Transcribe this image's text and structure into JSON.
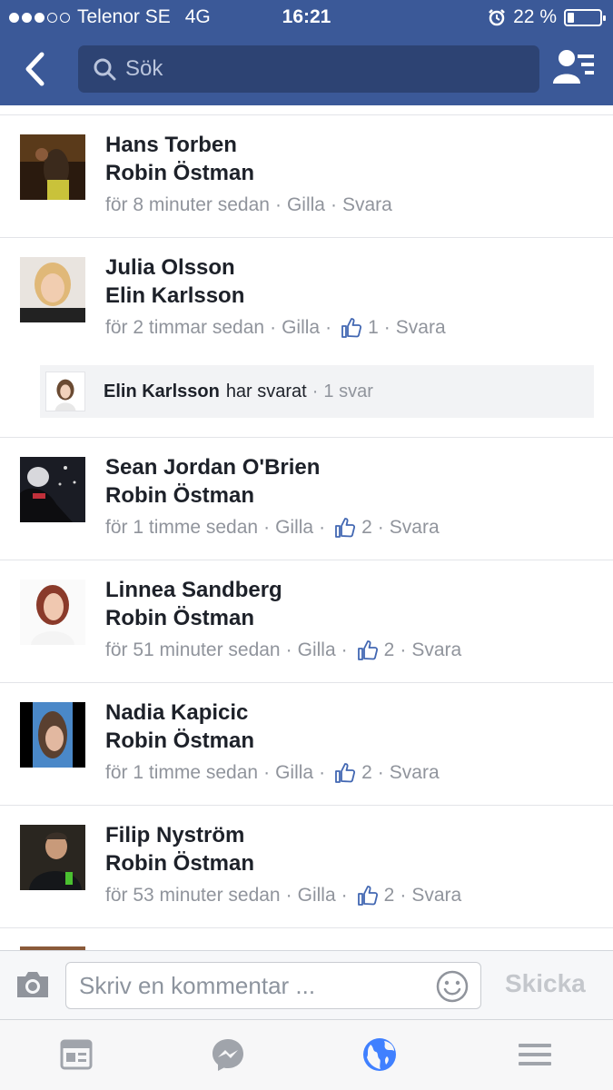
{
  "status_bar": {
    "carrier": "Telenor SE",
    "network": "4G",
    "time": "16:21",
    "battery": "22 %",
    "battery_level": 0.22,
    "signal_strength": 3
  },
  "nav": {
    "search_placeholder": "Sök"
  },
  "comments": [
    {
      "name": "Hans Torben",
      "tag": "Robin Östman",
      "time": "för 8 minuter sedan",
      "like": "Gilla",
      "reply": "Svara",
      "likes": null
    },
    {
      "name": "Julia Olsson",
      "tag": "Elin Karlsson",
      "time": "för 2 timmar sedan",
      "like": "Gilla",
      "reply": "Svara",
      "likes": "1",
      "reply_summary": {
        "name": "Elin Karlsson",
        "text": "har svarat",
        "count": "1 svar"
      }
    },
    {
      "name": "Sean Jordan O'Brien",
      "tag": "Robin Östman",
      "time": "för 1 timme sedan",
      "like": "Gilla",
      "reply": "Svara",
      "likes": "2"
    },
    {
      "name": "Linnea Sandberg",
      "tag": "Robin Östman",
      "time": "för 51 minuter sedan",
      "like": "Gilla",
      "reply": "Svara",
      "likes": "2"
    },
    {
      "name": "Nadia Kapicic",
      "tag": "Robin Östman",
      "time": "för 1 timme sedan",
      "like": "Gilla",
      "reply": "Svara",
      "likes": "2"
    },
    {
      "name": "Filip Nyström",
      "tag": "Robin Östman",
      "time": "för 53 minuter sedan",
      "like": "Gilla",
      "reply": "Svara",
      "likes": "2"
    }
  ],
  "composer": {
    "placeholder": "Skriv en kommentar ...",
    "send_label": "Skicka"
  },
  "tabs": [
    {
      "icon": "news-feed-icon"
    },
    {
      "icon": "messenger-icon"
    },
    {
      "icon": "notifications-globe-icon",
      "active": true
    },
    {
      "icon": "menu-icon"
    }
  ],
  "colors": {
    "brand": "#3b5998",
    "search_bg": "#2d4373",
    "meta_text": "#90949c",
    "like_blue": "#4267b2",
    "active_tab": "#4080ff",
    "inactive_tab": "#a0a4ab"
  }
}
